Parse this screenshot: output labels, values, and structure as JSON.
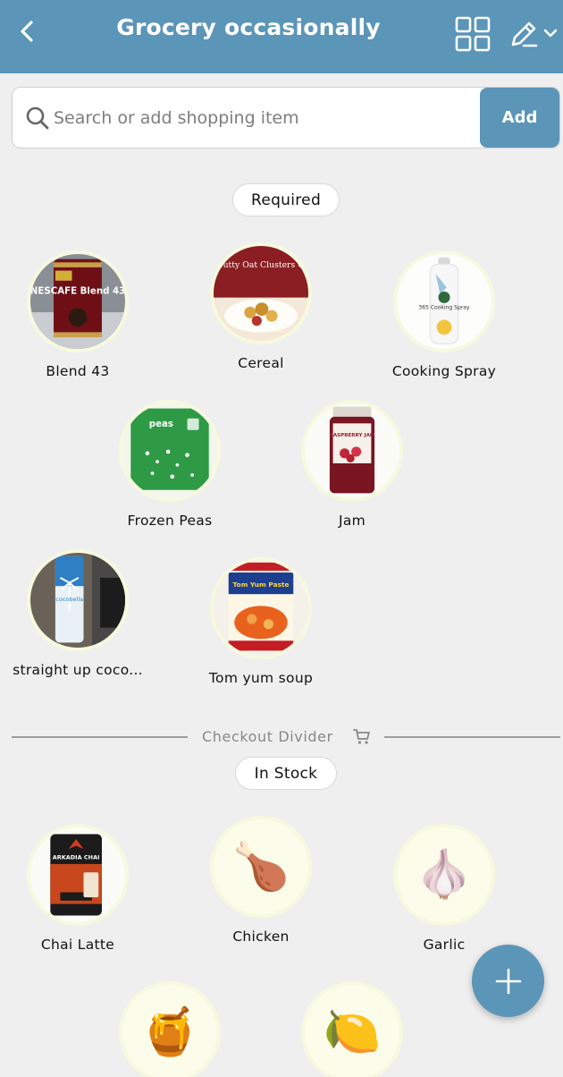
{
  "header": {
    "title": "Grocery occasionally",
    "back_icon": "chevron-left-icon",
    "grid_icon": "grid-view-icon",
    "edit_icon": "pencil-icon",
    "bg_color": "#5b95b8"
  },
  "search": {
    "placeholder": "Search or add shopping item",
    "value": "",
    "add_label": "Add"
  },
  "required": {
    "label": "Required",
    "items": [
      {
        "name": "Blend 43",
        "image": "nescafe-blend-43-tin",
        "image_text": "NESCAFE Blend 43"
      },
      {
        "name": "Cereal",
        "image": "super-nutty-oat-clusters-box",
        "image_text": "Super Nutty Oat Clusters CEREAL"
      },
      {
        "name": "Cooking Spray",
        "image": "cooking-spray-can",
        "image_text": "365 Cooking Spray"
      },
      {
        "name": "Frozen Peas",
        "image": "frozen-peas-bag",
        "image_text": "peas"
      },
      {
        "name": "Jam",
        "image": "raspberry-jam-jar",
        "image_text": "RASPBERRY JAM"
      },
      {
        "name": "straight up coco...",
        "image": "cocobella-coconut-water",
        "image_text": "cocobella"
      },
      {
        "name": "Tom yum soup",
        "image": "tom-yum-paste-jar",
        "image_text": "Tom Yum Paste"
      }
    ]
  },
  "divider": {
    "label": "Checkout Divider",
    "icon": "cart-icon"
  },
  "in_stock": {
    "label": "In Stock",
    "items": [
      {
        "name": "Chai Latte",
        "image": "arkadia-chai-tin",
        "image_text": "ARKADIA CHAI"
      },
      {
        "name": "Chicken",
        "emoji": "🍗",
        "icon": "chicken-leg-icon"
      },
      {
        "name": "Garlic",
        "emoji": "🧄",
        "icon": "garlic-icon"
      },
      {
        "name": "",
        "emoji": "🍯",
        "icon": "honey-pot-icon"
      },
      {
        "name": "",
        "emoji": "🍋",
        "icon": "lemon-icon"
      }
    ]
  },
  "fab": {
    "icon": "plus-icon"
  }
}
